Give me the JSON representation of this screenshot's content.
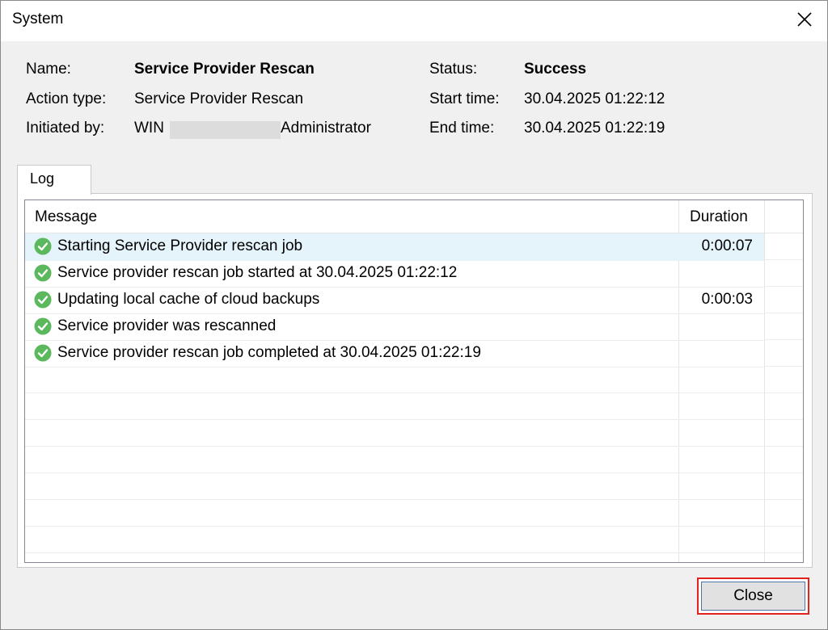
{
  "window": {
    "title": "System"
  },
  "info": {
    "name_label": "Name:",
    "name_value": "Service Provider Rescan",
    "action_type_label": "Action type:",
    "action_type_value": "Service Provider Rescan",
    "initiated_by_label": "Initiated by:",
    "initiated_by_prefix": "WIN",
    "initiated_by_suffix": "Administrator",
    "status_label": "Status:",
    "status_value": "Success",
    "start_time_label": "Start time:",
    "start_time_value": "30.04.2025 01:22:12",
    "end_time_label": "End time:",
    "end_time_value": "30.04.2025 01:22:19"
  },
  "tabs": [
    {
      "label": "Log"
    }
  ],
  "log": {
    "columns": {
      "message": "Message",
      "duration": "Duration"
    },
    "rows": [
      {
        "message": "Starting Service Provider rescan job",
        "duration": "0:00:07",
        "status_icon": "success-check-icon"
      },
      {
        "message": "Service provider rescan job started at 30.04.2025 01:22:12",
        "duration": "",
        "status_icon": "success-check-icon"
      },
      {
        "message": "Updating local cache of cloud backups",
        "duration": "0:00:03",
        "status_icon": "success-check-icon"
      },
      {
        "message": "Service provider was rescanned",
        "duration": "",
        "status_icon": "success-check-icon"
      },
      {
        "message": "Service provider rescan job completed at 30.04.2025 01:22:19",
        "duration": "",
        "status_icon": "success-check-icon"
      }
    ]
  },
  "buttons": {
    "close_label": "Close"
  },
  "colors": {
    "success_green": "#5cb85c",
    "selected_row": "#e5f3fb",
    "highlight_border": "#e0241d"
  }
}
